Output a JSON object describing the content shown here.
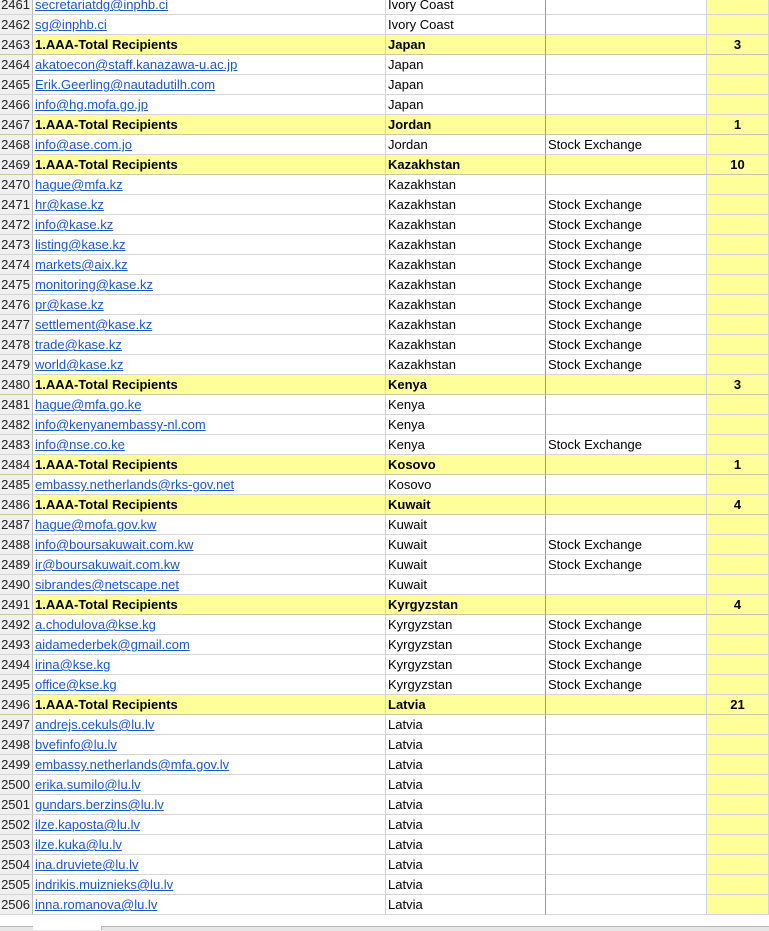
{
  "rows": [
    {
      "n": "2461",
      "email": "secretariatdg@inphb.ci",
      "country": "Ivory Coast",
      "type": "",
      "count": "",
      "total": false
    },
    {
      "n": "2462",
      "email": "sg@inphb.ci",
      "country": "Ivory Coast",
      "type": "",
      "count": "",
      "total": false
    },
    {
      "n": "2463",
      "email": "1.AAA-Total Recipients",
      "country": "Japan",
      "type": "",
      "count": "3",
      "total": true
    },
    {
      "n": "2464",
      "email": "akatoecon@staff.kanazawa-u.ac.jp",
      "country": "Japan",
      "type": "",
      "count": "",
      "total": false
    },
    {
      "n": "2465",
      "email": "Erik.Geerling@nautadutilh.com",
      "country": "Japan",
      "type": "",
      "count": "",
      "total": false
    },
    {
      "n": "2466",
      "email": "info@hg.mofa.go.jp",
      "country": "Japan",
      "type": "",
      "count": "",
      "total": false
    },
    {
      "n": "2467",
      "email": "1.AAA-Total Recipients",
      "country": "Jordan",
      "type": "",
      "count": "1",
      "total": true
    },
    {
      "n": "2468",
      "email": "info@ase.com.jo",
      "country": "Jordan",
      "type": "Stock Exchange",
      "count": "",
      "total": false
    },
    {
      "n": "2469",
      "email": "1.AAA-Total Recipients",
      "country": "Kazakhstan",
      "type": "",
      "count": "10",
      "total": true
    },
    {
      "n": "2470",
      "email": "hague@mfa.kz",
      "country": "Kazakhstan",
      "type": "",
      "count": "",
      "total": false
    },
    {
      "n": "2471",
      "email": "hr@kase.kz",
      "country": "Kazakhstan",
      "type": "Stock Exchange",
      "count": "",
      "total": false
    },
    {
      "n": "2472",
      "email": "info@kase.kz",
      "country": "Kazakhstan",
      "type": "Stock Exchange",
      "count": "",
      "total": false
    },
    {
      "n": "2473",
      "email": "listing@kase.kz",
      "country": "Kazakhstan",
      "type": "Stock Exchange",
      "count": "",
      "total": false
    },
    {
      "n": "2474",
      "email": "markets@aix.kz",
      "country": "Kazakhstan",
      "type": "Stock Exchange",
      "count": "",
      "total": false
    },
    {
      "n": "2475",
      "email": "monitoring@kase.kz",
      "country": "Kazakhstan",
      "type": "Stock Exchange",
      "count": "",
      "total": false
    },
    {
      "n": "2476",
      "email": "pr@kase.kz",
      "country": "Kazakhstan",
      "type": "Stock Exchange",
      "count": "",
      "total": false
    },
    {
      "n": "2477",
      "email": "settlement@kase.kz",
      "country": "Kazakhstan",
      "type": "Stock Exchange",
      "count": "",
      "total": false
    },
    {
      "n": "2478",
      "email": "trade@kase.kz",
      "country": "Kazakhstan",
      "type": "Stock Exchange",
      "count": "",
      "total": false
    },
    {
      "n": "2479",
      "email": "world@kase.kz",
      "country": "Kazakhstan",
      "type": "Stock Exchange",
      "count": "",
      "total": false
    },
    {
      "n": "2480",
      "email": "1.AAA-Total Recipients",
      "country": "Kenya",
      "type": "",
      "count": "3",
      "total": true
    },
    {
      "n": "2481",
      "email": "hague@mfa.go.ke",
      "country": "Kenya",
      "type": "",
      "count": "",
      "total": false
    },
    {
      "n": "2482",
      "email": "info@kenyanembassy-nl.com",
      "country": "Kenya",
      "type": "",
      "count": "",
      "total": false
    },
    {
      "n": "2483",
      "email": "info@nse.co.ke",
      "country": "Kenya",
      "type": "Stock Exchange",
      "count": "",
      "total": false
    },
    {
      "n": "2484",
      "email": "1.AAA-Total Recipients",
      "country": "Kosovo",
      "type": "",
      "count": "1",
      "total": true
    },
    {
      "n": "2485",
      "email": "embassy.netherlands@rks-gov.net",
      "country": "Kosovo",
      "type": "",
      "count": "",
      "total": false
    },
    {
      "n": "2486",
      "email": "1.AAA-Total Recipients",
      "country": "Kuwait",
      "type": "",
      "count": "4",
      "total": true
    },
    {
      "n": "2487",
      "email": "hague@mofa.gov.kw",
      "country": "Kuwait",
      "type": "",
      "count": "",
      "total": false
    },
    {
      "n": "2488",
      "email": "info@boursakuwait.com.kw",
      "country": "Kuwait",
      "type": "Stock Exchange",
      "count": "",
      "total": false
    },
    {
      "n": "2489",
      "email": "ir@boursakuwait.com.kw",
      "country": "Kuwait",
      "type": "Stock Exchange",
      "count": "",
      "total": false
    },
    {
      "n": "2490",
      "email": "sibrandes@netscape.net",
      "country": "Kuwait",
      "type": "",
      "count": "",
      "total": false
    },
    {
      "n": "2491",
      "email": "1.AAA-Total Recipients",
      "country": "Kyrgyzstan",
      "type": "",
      "count": "4",
      "total": true
    },
    {
      "n": "2492",
      "email": "a.chodulova@kse.kg",
      "country": "Kyrgyzstan",
      "type": "Stock Exchange",
      "count": "",
      "total": false
    },
    {
      "n": "2493",
      "email": "aidamederbek@gmail.com",
      "country": "Kyrgyzstan",
      "type": "Stock Exchange",
      "count": "",
      "total": false
    },
    {
      "n": "2494",
      "email": "irina@kse.kg",
      "country": "Kyrgyzstan",
      "type": "Stock Exchange",
      "count": "",
      "total": false
    },
    {
      "n": "2495",
      "email": "office@kse.kg",
      "country": "Kyrgyzstan",
      "type": "Stock Exchange",
      "count": "",
      "total": false
    },
    {
      "n": "2496",
      "email": "1.AAA-Total Recipients",
      "country": "Latvia",
      "type": "",
      "count": "21",
      "total": true
    },
    {
      "n": "2497",
      "email": "andrejs.cekuls@lu.lv",
      "country": "Latvia",
      "type": "",
      "count": "",
      "total": false
    },
    {
      "n": "2498",
      "email": "bvefinfo@lu.lv",
      "country": "Latvia",
      "type": "",
      "count": "",
      "total": false
    },
    {
      "n": "2499",
      "email": "embassy.netherlands@mfa.gov.lv",
      "country": "Latvia",
      "type": "",
      "count": "",
      "total": false
    },
    {
      "n": "2500",
      "email": "erika.sumilo@lu.lv",
      "country": "Latvia",
      "type": "",
      "count": "",
      "total": false
    },
    {
      "n": "2501",
      "email": "gundars.berzins@lu.lv",
      "country": "Latvia",
      "type": "",
      "count": "",
      "total": false
    },
    {
      "n": "2502",
      "email": "ilze.kaposta@lu.lv",
      "country": "Latvia",
      "type": "",
      "count": "",
      "total": false
    },
    {
      "n": "2503",
      "email": "ilze.kuka@lu.lv",
      "country": "Latvia",
      "type": "",
      "count": "",
      "total": false
    },
    {
      "n": "2504",
      "email": "ina.druviete@lu.lv",
      "country": "Latvia",
      "type": "",
      "count": "",
      "total": false
    },
    {
      "n": "2505",
      "email": "indrikis.muiznieks@lu.lv",
      "country": "Latvia",
      "type": "",
      "count": "",
      "total": false
    },
    {
      "n": "2506",
      "email": "inna.romanova@lu.lv",
      "country": "Latvia",
      "type": "",
      "count": "",
      "total": false
    }
  ]
}
